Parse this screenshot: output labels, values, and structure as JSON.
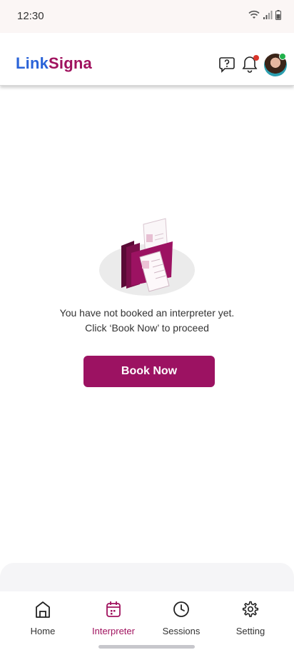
{
  "status_bar": {
    "time": "12:30"
  },
  "header": {
    "logo_part1": "Link",
    "logo_part2": "Signa",
    "icons": [
      "help-chat-icon",
      "bell-icon",
      "avatar"
    ]
  },
  "empty_state": {
    "line1": "You have not booked an interpreter yet.",
    "line2": "Click ‘Book Now’ to proceed",
    "button_label": "Book Now"
  },
  "bottom_nav": {
    "items": [
      {
        "label": "Home",
        "icon": "home-icon",
        "active": false
      },
      {
        "label": "Interpreter",
        "icon": "calendar-icon",
        "active": true
      },
      {
        "label": "Sessions",
        "icon": "clock-icon",
        "active": false
      },
      {
        "label": "Setting",
        "icon": "gear-icon",
        "active": false
      }
    ]
  },
  "colors": {
    "brand_blue": "#2a63d8",
    "brand_magenta": "#a0125e",
    "button": "#9c1262",
    "notification": "#d9352b",
    "online": "#21b04b"
  }
}
